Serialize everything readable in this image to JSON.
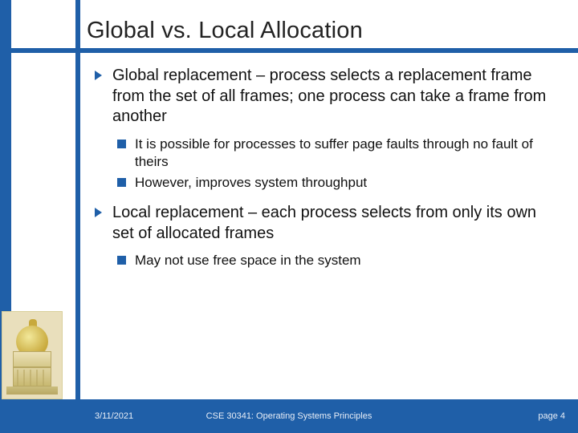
{
  "title": "Global vs. Local Allocation",
  "bullets": [
    {
      "text": "Global replacement – process selects a replacement frame from the set of all frames; one process can take a frame from another",
      "sub": [
        "It is possible for processes to suffer page faults through no fault of theirs",
        "However, improves system throughput"
      ]
    },
    {
      "text": "Local replacement – each process selects from only its own set of allocated frames",
      "sub": [
        "May not use free space in the system"
      ]
    }
  ],
  "footer": {
    "date": "3/11/2021",
    "course": "CSE 30341: Operating Systems Principles",
    "page": "page 4"
  },
  "colors": {
    "brand_blue": "#1f5fa8",
    "tan": "#e9dfbc"
  }
}
